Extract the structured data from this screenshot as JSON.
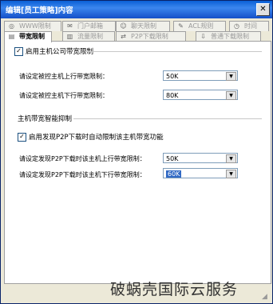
{
  "window": {
    "title": "编辑[员工策略]内容",
    "close_glyph": "✕"
  },
  "tabs_top": [
    {
      "label": "WWW限制",
      "icon": "globe-icon"
    },
    {
      "label": "门户邮箱",
      "icon": "mail-icon"
    },
    {
      "label": "聊天限制",
      "icon": "chat-icon"
    },
    {
      "label": "ACL规则",
      "icon": "acl-icon"
    },
    {
      "label": "时间",
      "icon": "clock-icon"
    }
  ],
  "tabs_bottom": [
    {
      "label": "带宽限制",
      "icon": "bandwidth-icon",
      "active": true
    },
    {
      "label": "流量限制",
      "icon": "traffic-icon"
    },
    {
      "label": "P2P下载限制",
      "icon": "p2p-icon"
    },
    {
      "label": "普通下载限制",
      "icon": "download-icon"
    }
  ],
  "bandwidth": {
    "enable_label": "启用主机公司带宽限制",
    "enabled": true,
    "upload_label": "请设定被控主机上行带宽限制：",
    "upload_value": "50K",
    "download_label": "请设定被控主机下行带宽限制：",
    "download_value": "80K"
  },
  "smart": {
    "section_title": "主机带宽智能抑制",
    "enable_label": "启用发现P2P下载时自动限制该主机带宽功能",
    "enabled": true,
    "upload_label": "请设定发现P2P下载时该主机上行带宽限制：",
    "upload_value": "50K",
    "download_label": "请设定发现P2P下载时该主机下行带宽限制：",
    "download_value": "60K"
  },
  "watermark": "破蜗壳国际云服务"
}
